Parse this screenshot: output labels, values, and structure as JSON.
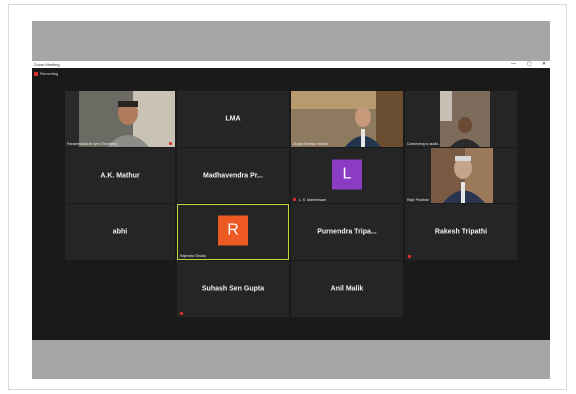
{
  "window": {
    "title": "Zoom Meeting",
    "recording_label": "Recording",
    "controls": [
      "—",
      "▢",
      "✕"
    ]
  },
  "tiles": {
    "parameshwaran": {
      "label": "Parameshwaran Iyer (Secretary)"
    },
    "lma": {
      "name": "LMA"
    },
    "durga": {
      "label": "Durga Shankar Mishra"
    },
    "connecting": {
      "label": "Connecting to audio..."
    },
    "ak_mathur": {
      "name": "A.K. Mathur"
    },
    "madhavendra": {
      "name": "Madhavendra Pr..."
    },
    "lk": {
      "avatar": "L",
      "label": "L. K. Maheshwari"
    },
    "rajiv": {
      "label": "Rajiv Pradhan"
    },
    "abhi": {
      "name": "abhi"
    },
    "rajendra": {
      "avatar": "R",
      "label": "Rajendra Shukla"
    },
    "purnendra": {
      "name": "Purnendra Tripa..."
    },
    "rakesh": {
      "name": "Rakesh Tripathi"
    },
    "suhash": {
      "name": "Suhash Sen Gupta"
    },
    "anil": {
      "name": "Anil Malik"
    }
  },
  "colors": {
    "avatar_l": "#8a3cc4",
    "avatar_r": "#ee5a24",
    "active_border": "#c7d33a",
    "mic_muted": "#e0312c"
  }
}
